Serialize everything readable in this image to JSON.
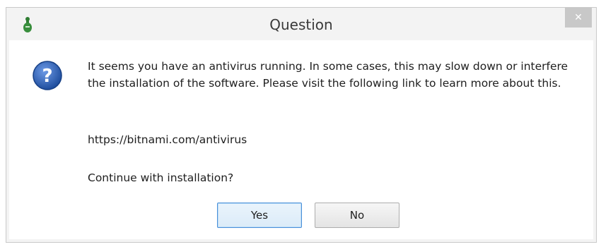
{
  "window": {
    "title": "Question",
    "close_glyph": "✕"
  },
  "message": {
    "body": "It seems you have an antivirus running. In some cases, this may slow down or interfere the installation of the software. Please visit the following link to learn more about this.",
    "link": "https://bitnami.com/antivirus",
    "prompt": "Continue with installation?"
  },
  "buttons": {
    "yes_label": "Yes",
    "no_label": "No"
  },
  "icons": {
    "app": "bitnami-installer-icon",
    "dialog": "question-icon"
  },
  "colors": {
    "question_icon": "#2f5fb3",
    "default_button_border": "#4a90d9"
  }
}
